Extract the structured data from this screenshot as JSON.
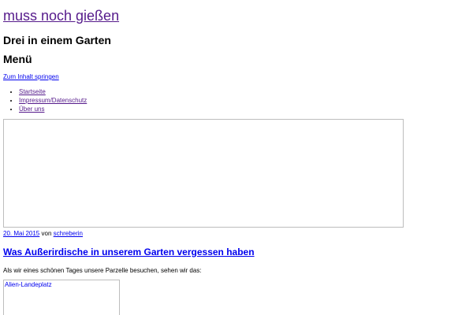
{
  "site": {
    "title": "muss noch gießen",
    "description": "Drei in einem Garten"
  },
  "navigation": {
    "menu_label": "Menü",
    "skip_link": "Zum Inhalt springen",
    "items": [
      {
        "label": "Startseite"
      },
      {
        "label": "Impressum/Datenschutz"
      },
      {
        "label": "Über uns"
      }
    ]
  },
  "post": {
    "date": "20. Mai 2015",
    "by_label": "von",
    "author": "schreberin",
    "title": "Was Außerirdische in unserem Garten vergessen haben",
    "text": "Als wir eines schönen Tages unsere Parzelle besuchen, sehen wir das:",
    "image_alt": "Alien-Landeplatz"
  },
  "colors": {
    "link": "#0000ee",
    "visited_link": "#551a8b",
    "image_border": "#bdbdbd"
  }
}
